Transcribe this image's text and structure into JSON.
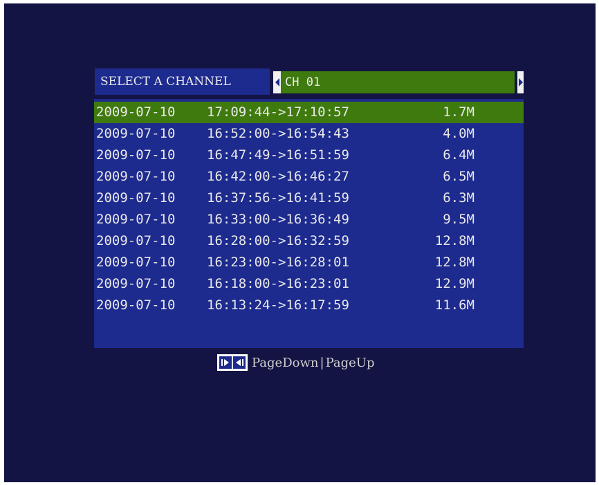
{
  "header": {
    "label": "SELECT A CHANNEL",
    "channel_value": "CH 01"
  },
  "recordings": [
    {
      "date": "2009-07-10",
      "time_range": "17:09:44->17:10:57",
      "size": "1.7M"
    },
    {
      "date": "2009-07-10",
      "time_range": "16:52:00->16:54:43",
      "size": "4.0M"
    },
    {
      "date": "2009-07-10",
      "time_range": "16:47:49->16:51:59",
      "size": "6.4M"
    },
    {
      "date": "2009-07-10",
      "time_range": "16:42:00->16:46:27",
      "size": "6.5M"
    },
    {
      "date": "2009-07-10",
      "time_range": "16:37:56->16:41:59",
      "size": "6.3M"
    },
    {
      "date": "2009-07-10",
      "time_range": "16:33:00->16:36:49",
      "size": "9.5M"
    },
    {
      "date": "2009-07-10",
      "time_range": "16:28:00->16:32:59",
      "size": "12.8M"
    },
    {
      "date": "2009-07-10",
      "time_range": "16:23:00->16:28:01",
      "size": "12.8M"
    },
    {
      "date": "2009-07-10",
      "time_range": "16:18:00->16:23:01",
      "size": "12.9M"
    },
    {
      "date": "2009-07-10",
      "time_range": "16:13:24->16:17:59",
      "size": "11.6M"
    }
  ],
  "selected_index": 0,
  "pager": {
    "icon": "page-nav-icon",
    "page_down": "PageDown",
    "separator": "|",
    "page_up": "PageUp"
  },
  "colors": {
    "screen_bg": "#141444",
    "panel_bg": "#1d2a8e",
    "selection_bg": "#3f7a0e",
    "text": "#e8e8e8"
  }
}
